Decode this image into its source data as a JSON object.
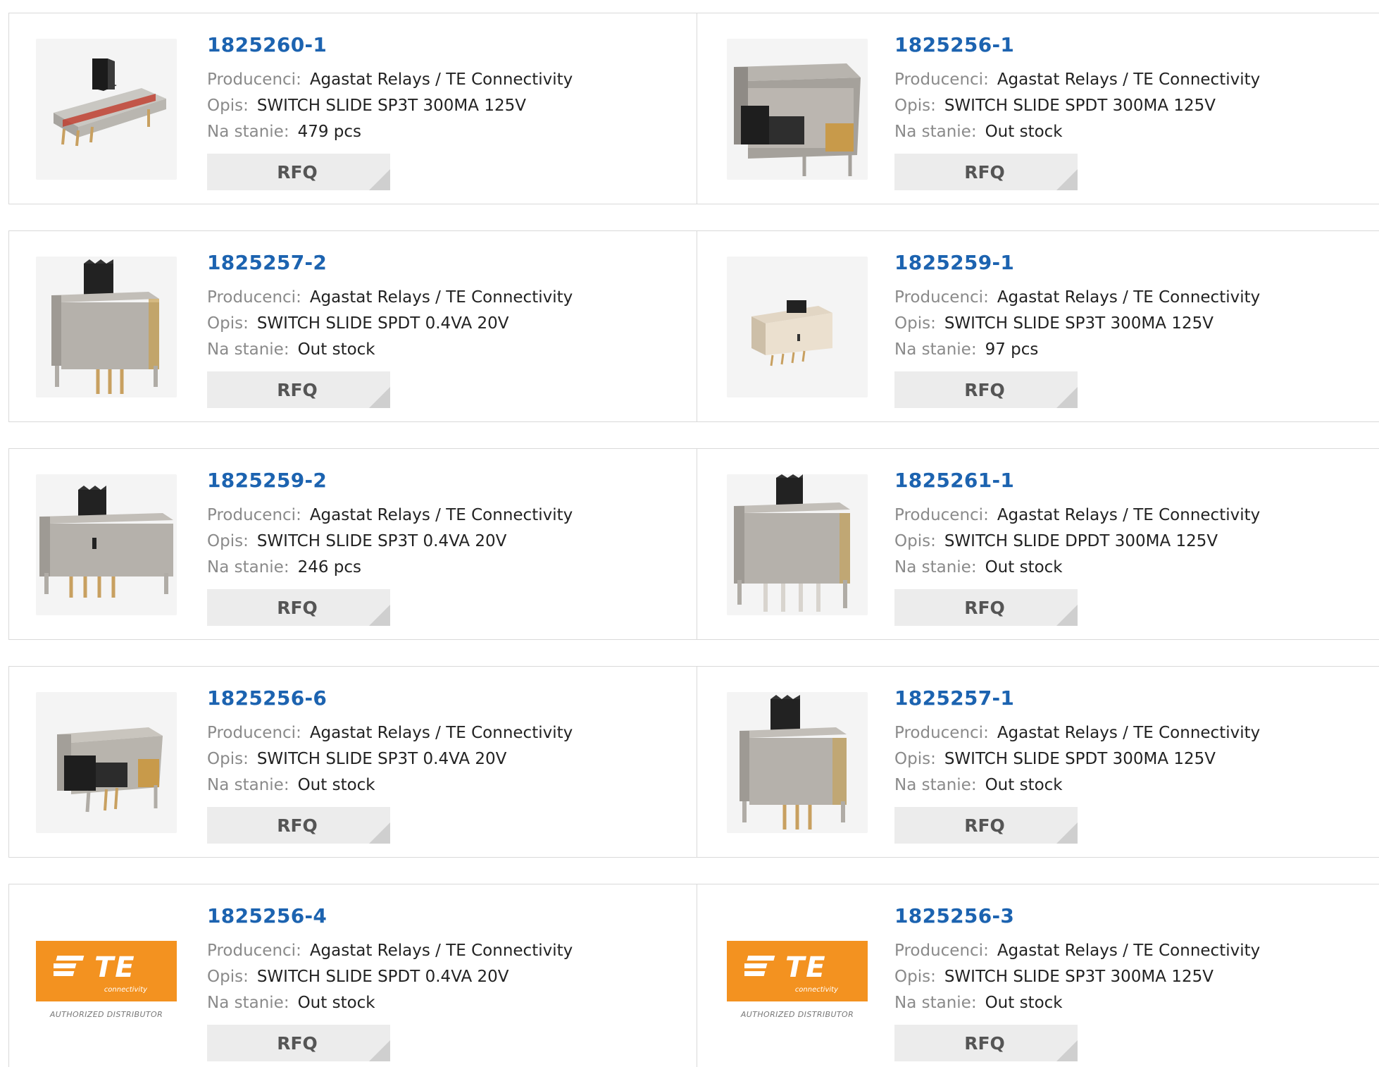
{
  "labels": {
    "manufacturer": "Producenci:",
    "description": "Opis:",
    "stock": "Na stanie:",
    "rfq": "RFQ"
  },
  "products": [
    {
      "pn": "1825260-1",
      "manufacturer": "Agastat Relays / TE Connectivity",
      "description": "SWITCH SLIDE SP3T 300MA 125V",
      "stock": "479 pcs",
      "image": "slide-switch-horizontal-red"
    },
    {
      "pn": "1825256-1",
      "manufacturer": "Agastat Relays / TE Connectivity",
      "description": "SWITCH SLIDE SPDT 300MA 125V",
      "stock": "Out stock",
      "image": "slide-switch-metal-box"
    },
    {
      "pn": "1825257-2",
      "manufacturer": "Agastat Relays / TE Connectivity",
      "description": "SWITCH SLIDE SPDT 0.4VA 20V",
      "stock": "Out stock",
      "image": "slide-switch-vertical"
    },
    {
      "pn": "1825259-1",
      "manufacturer": "Agastat Relays / TE Connectivity",
      "description": "SWITCH SLIDE SP3T 300MA 125V",
      "stock": "97 pcs",
      "image": "slide-switch-small-beige"
    },
    {
      "pn": "1825259-2",
      "manufacturer": "Agastat Relays / TE Connectivity",
      "description": "SWITCH SLIDE SP3T 0.4VA 20V",
      "stock": "246 pcs",
      "image": "slide-switch-wide"
    },
    {
      "pn": "1825261-1",
      "manufacturer": "Agastat Relays / TE Connectivity",
      "description": "SWITCH SLIDE DPDT 300MA 125V",
      "stock": "Out stock",
      "image": "slide-switch-vertical-six-pin"
    },
    {
      "pn": "1825256-6",
      "manufacturer": "Agastat Relays / TE Connectivity",
      "description": "SWITCH SLIDE SP3T 0.4VA 20V",
      "stock": "Out stock",
      "image": "slide-switch-metal-box"
    },
    {
      "pn": "1825257-1",
      "manufacturer": "Agastat Relays / TE Connectivity",
      "description": "SWITCH SLIDE SPDT 300MA 125V",
      "stock": "Out stock",
      "image": "slide-switch-vertical"
    },
    {
      "pn": "1825256-4",
      "manufacturer": "Agastat Relays / TE Connectivity",
      "description": "SWITCH SLIDE SPDT 0.4VA 20V",
      "stock": "Out stock",
      "image": "te-logo"
    },
    {
      "pn": "1825256-3",
      "manufacturer": "Agastat Relays / TE Connectivity",
      "description": "SWITCH SLIDE SP3T 300MA 125V",
      "stock": "Out stock",
      "image": "te-logo"
    }
  ],
  "te_logo": {
    "mark": "TE",
    "sub": "connectivity",
    "caption": "AUTHORIZED DISTRIBUTOR",
    "color": "#f39220"
  },
  "colors": {
    "part_number": "#1c63b0",
    "label": "#8a8a8a",
    "rfq_bg": "#ececec"
  }
}
